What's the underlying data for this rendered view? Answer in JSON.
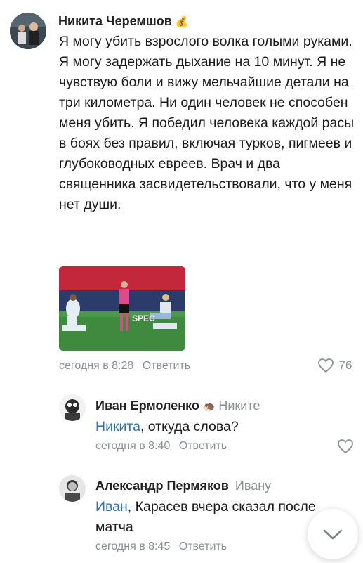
{
  "comments": [
    {
      "author": "Никита Черемшов",
      "badge": "money-bag-icon",
      "text": "Я могу убить взрослого волка голыми руками. Я могу задержать дыхание на 10 минут. Я не чувствую боли и вижу мельчайшие детали на три километра. Ни один человек не способен меня убить. Я победил человека каждой расы в боях без правил, включая турков, пигмеев и глубоководных евреев. Врач и два священника засвидетельствовали, что у меня нет души.",
      "photo_overlay_text": "SPEC",
      "time": "сегодня в 8:28",
      "reply_label": "Ответить",
      "likes": "76"
    },
    {
      "author": "Иван Ермоленко",
      "badge": "hedgehog-icon",
      "addressee": "Никите",
      "mention": "Никита",
      "text": ", откуда слова?",
      "time": "сегодня в 8:40",
      "reply_label": "Ответить"
    },
    {
      "author": "Александр Пермяков",
      "addressee": "Ивану",
      "mention": "Иван",
      "text": ", Карасев вчера сказал после матча",
      "time": "сегодня в 8:45",
      "reply_label": "Ответить"
    }
  ],
  "scroll_button": "chevron-down-icon"
}
